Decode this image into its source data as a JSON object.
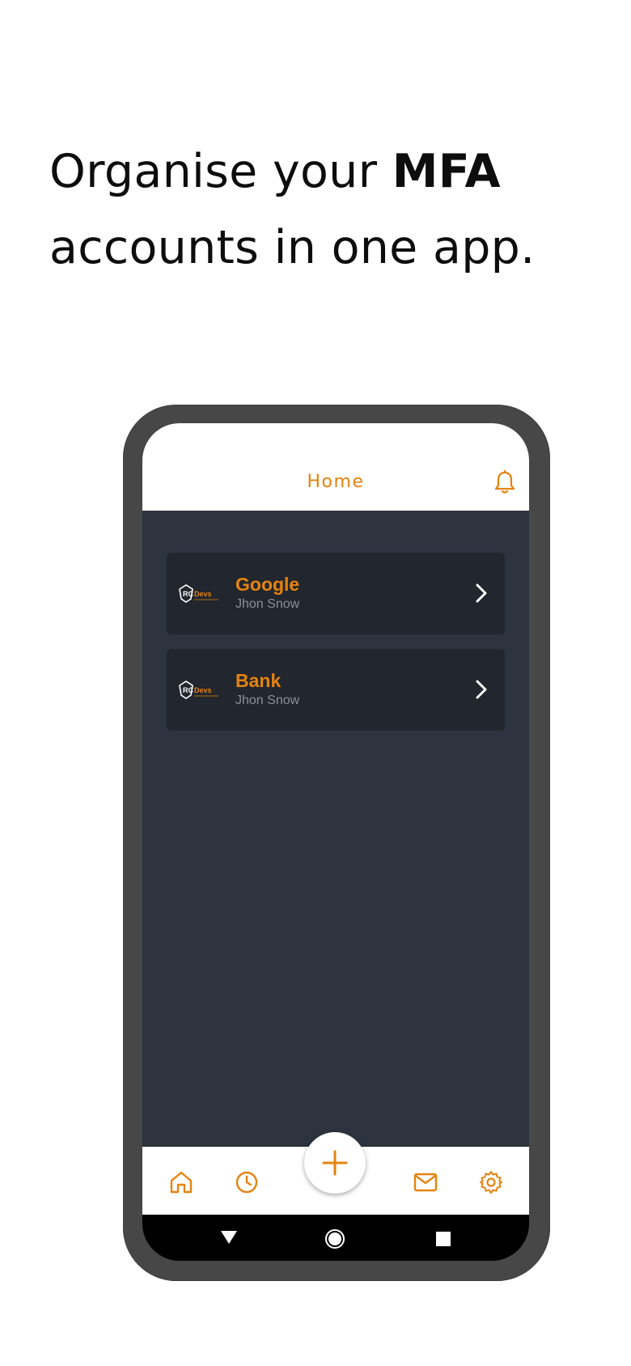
{
  "headline": {
    "part1": "Organise your ",
    "bold": "MFA",
    "part2": "accounts in one app."
  },
  "app": {
    "header_title": "Home",
    "accent_color": "#e5830f",
    "background_color": "#2d333f",
    "card_color": "#22262e",
    "accounts": [
      {
        "name": "Google",
        "user": "Jhon Snow",
        "logo": "rcdevs-logo"
      },
      {
        "name": "Bank",
        "user": "Jhon Snow",
        "logo": "rcdevs-logo"
      }
    ],
    "logo_text": {
      "rc": "RC",
      "devs": "Devs"
    },
    "nav_icons": [
      "home-icon",
      "clock-icon",
      "plus-icon",
      "mail-icon",
      "gear-icon"
    ],
    "system_icons": [
      "back-triangle-icon",
      "home-circle-icon",
      "recents-square-icon"
    ]
  }
}
